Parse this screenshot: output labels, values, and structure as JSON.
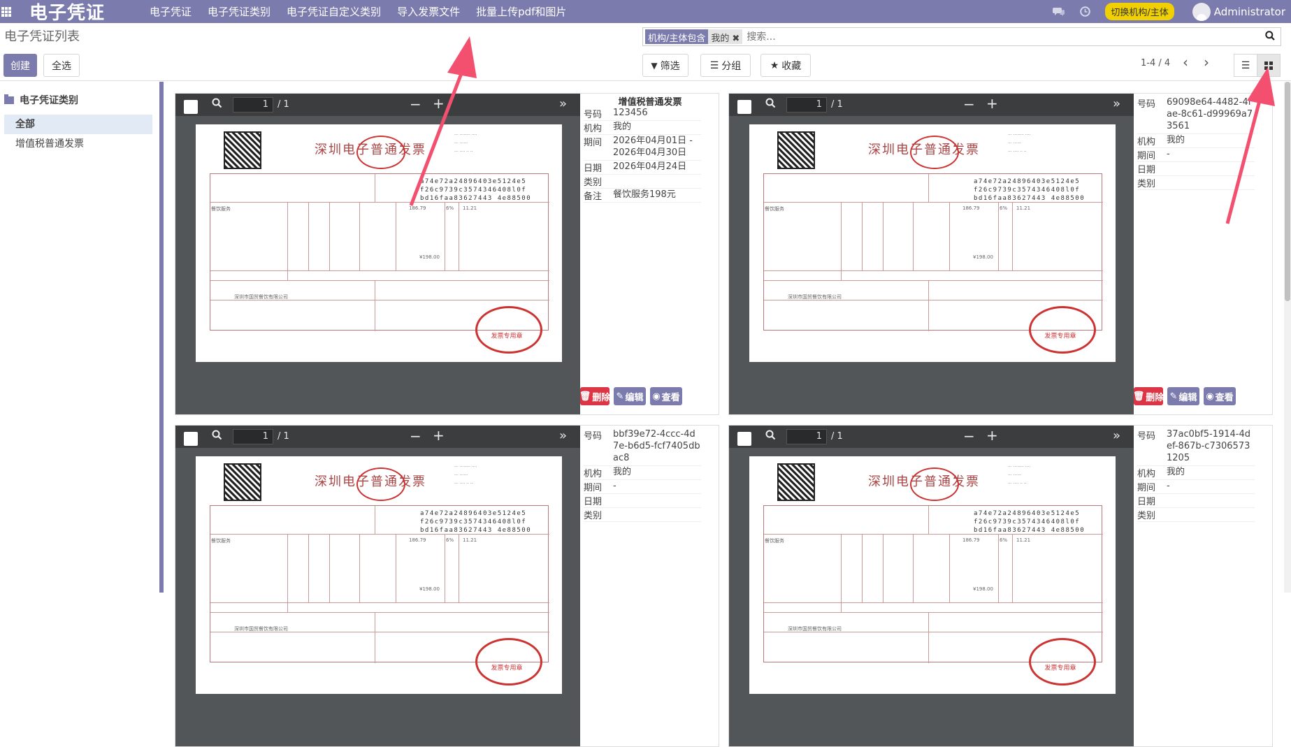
{
  "app": {
    "title": "电子凭证",
    "menu": [
      "电子凭证",
      "电子凭证类别",
      "电子凭证自定义类别",
      "导入发票文件",
      "批量上传pdf和图片"
    ],
    "switch_label": "切换机构/主体",
    "user": "Administrator",
    "accent": "#7c7bad"
  },
  "control": {
    "page_title": "电子凭证列表",
    "facet_label": "机构/主体包含",
    "facet_value": "我的",
    "search_placeholder": "搜索...",
    "create": "创建",
    "select_all": "全选",
    "filter": "筛选",
    "group": "分组",
    "favorite": "收藏",
    "pager": "1-4 / 4"
  },
  "sidebar": {
    "heading": "电子凭证类别",
    "items": [
      "全部",
      "增值税普通发票"
    ]
  },
  "viewer": {
    "page": "1",
    "total": "/ 1"
  },
  "invoice": {
    "title": "深圳电子普通发票",
    "seal": "发票专用章",
    "cipher": [
      "a74e72a24896403e5124e5",
      "f26c9739c3574346408l0f",
      "bd16faa83627443 4e88500"
    ],
    "service": "餐饮服务",
    "amount": "186.79",
    "tax_rate": "6%",
    "tax": "11.21",
    "total_label": "¥198.00",
    "seller": "深圳市国贸餐饮有限公司"
  },
  "cards": [
    {
      "title": "增值税普通发票",
      "fields": [
        {
          "k": "号码",
          "v": "123456"
        },
        {
          "k": "机构",
          "v": "我的"
        },
        {
          "k": "期间",
          "v": "2026年04月01日 - 2026年04月30日"
        },
        {
          "k": "日期",
          "v": "2026年04月24日"
        },
        {
          "k": "类别",
          "v": ""
        },
        {
          "k": "备注",
          "v": "餐饮服务198元"
        }
      ]
    },
    {
      "title": "",
      "fields": [
        {
          "k": "号码",
          "v": "69098e64-4482-4fae-8c61-d99969a73561"
        },
        {
          "k": "机构",
          "v": "我的"
        },
        {
          "k": "期间",
          "v": "-"
        },
        {
          "k": "日期",
          "v": ""
        },
        {
          "k": "类别",
          "v": ""
        }
      ]
    },
    {
      "title": "",
      "fields": [
        {
          "k": "号码",
          "v": "bbf39e72-4ccc-4d7e-b6d5-fcf7405dbac8"
        },
        {
          "k": "机构",
          "v": "我的"
        },
        {
          "k": "期间",
          "v": "-"
        },
        {
          "k": "日期",
          "v": ""
        },
        {
          "k": "类别",
          "v": ""
        }
      ]
    },
    {
      "title": "",
      "fields": [
        {
          "k": "号码",
          "v": "37ac0bf5-1914-4def-867b-c73065731205"
        },
        {
          "k": "机构",
          "v": "我的"
        },
        {
          "k": "期间",
          "v": "-"
        },
        {
          "k": "日期",
          "v": ""
        },
        {
          "k": "类别",
          "v": ""
        }
      ]
    }
  ],
  "actions": {
    "delete": "删除",
    "edit": "编辑",
    "view": "查看"
  }
}
